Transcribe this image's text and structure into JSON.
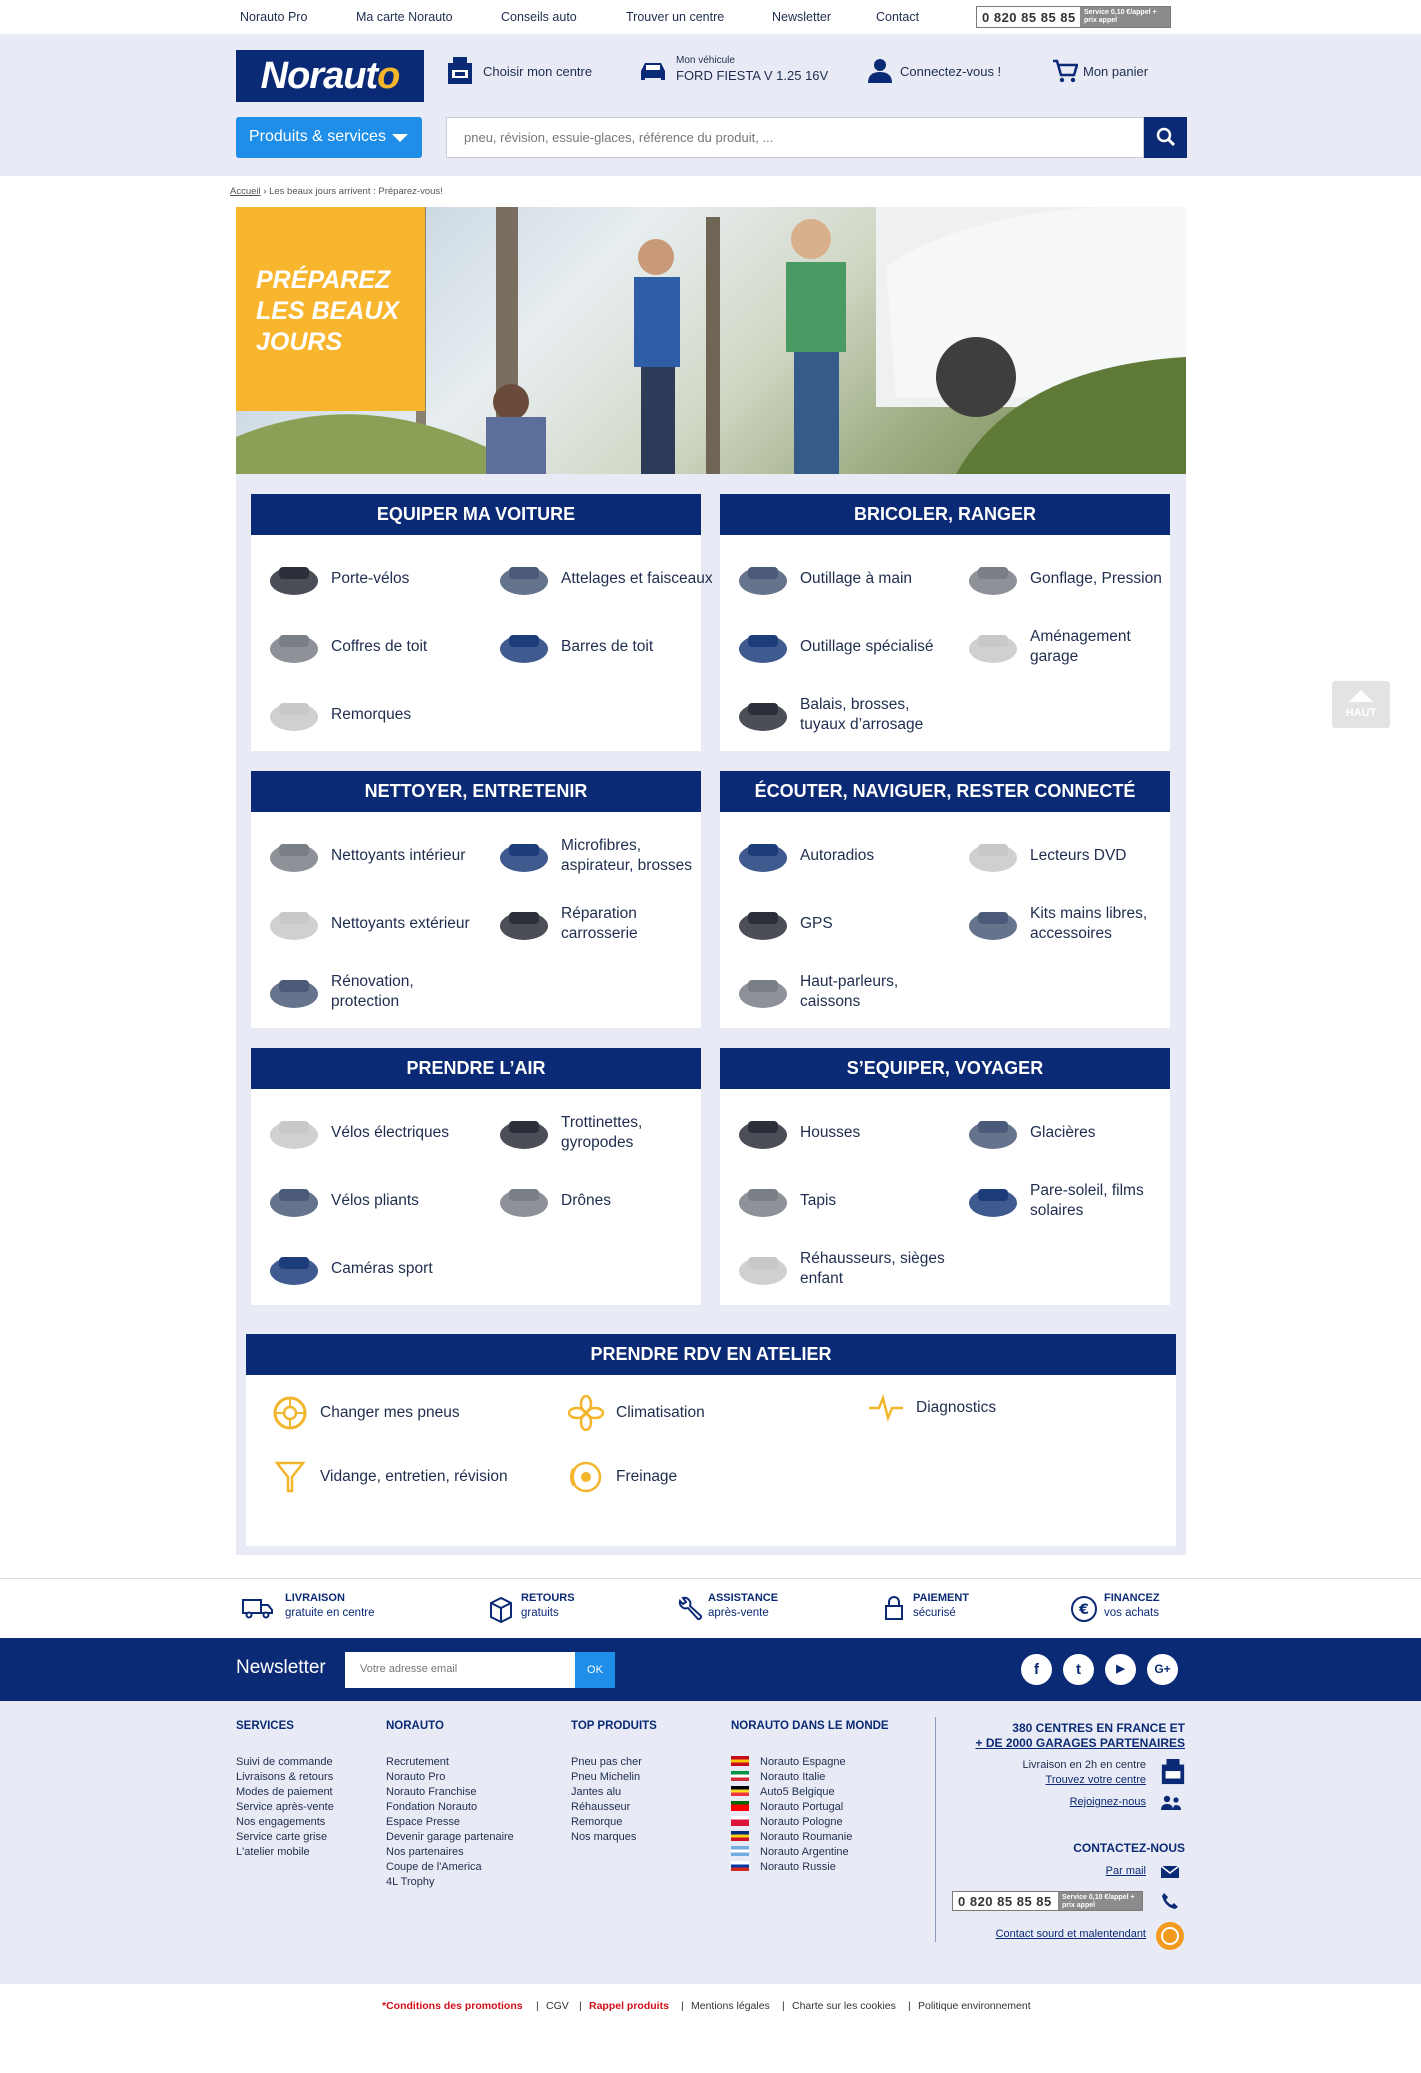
{
  "topbar": {
    "links": [
      "Norauto Pro",
      "Ma carte Norauto",
      "Conseils auto",
      "Trouver un centre",
      "Newsletter",
      "Contact"
    ],
    "phone": "0 820 85 85 85",
    "phone_tag": "Service 0,10 €/appel + prix appel"
  },
  "header": {
    "logo_text": "Norauto",
    "choose_center": "Choisir mon centre",
    "vehicle_label": "Mon véhicule",
    "vehicle_name": "FORD FIESTA V 1.25 16V",
    "login": "Connectez-vous !",
    "cart": "Mon panier",
    "products_button": "Produits & services",
    "search_placeholder": "pneu, révision, essuie-glaces, référence du produit, ..."
  },
  "breadcrumb": {
    "home": "Accueil",
    "separator": " › ",
    "current": "Les beaux jours arrivent : Préparez-vous!"
  },
  "hero": {
    "title_lines": [
      "PRÉPAREZ",
      "LES BEAUX",
      "JOURS"
    ]
  },
  "categories": [
    {
      "title": "EQUIPER MA VOITURE",
      "items": [
        {
          "label": "Porte-vélos",
          "icon": "bike-rack-icon"
        },
        {
          "label": "Attelages et faisceaux",
          "icon": "towbar-icon"
        },
        {
          "label": "Coffres de toit",
          "icon": "roof-box-icon"
        },
        {
          "label": "Barres de toit",
          "icon": "roof-bars-icon"
        },
        {
          "label": "Remorques",
          "icon": "trailer-icon"
        }
      ]
    },
    {
      "title": "BRICOLER, RANGER",
      "items": [
        {
          "label": "Outillage à main",
          "icon": "toolbox-icon"
        },
        {
          "label": "Gonflage, Pression",
          "icon": "compressor-icon"
        },
        {
          "label": "Outillage spécialisé",
          "icon": "creeper-icon"
        },
        {
          "label": "Aménagement garage",
          "icon": "tool-cabinet-icon"
        },
        {
          "label": "Balais, brosses, tuyaux d’arrosage",
          "icon": "brush-icon"
        }
      ]
    },
    {
      "title": "NETTOYER, ENTRETENIR",
      "items": [
        {
          "label": "Nettoyants intérieur",
          "icon": "spray-bottles-icon"
        },
        {
          "label": "Microfibres, aspirateur, brosses",
          "icon": "vacuum-icon"
        },
        {
          "label": "Nettoyants extérieur",
          "icon": "cleaner-bottles-icon"
        },
        {
          "label": "Réparation carrosserie",
          "icon": "repair-kit-icon"
        },
        {
          "label": "Rénovation, protection",
          "icon": "polish-icon"
        }
      ]
    },
    {
      "title": "ÉCOUTER, NAVIGUER, RESTER CONNECTÉ",
      "items": [
        {
          "label": "Autoradios",
          "icon": "car-radio-icon"
        },
        {
          "label": "Lecteurs DVD",
          "icon": "dvd-player-icon"
        },
        {
          "label": "GPS",
          "icon": "gps-icon"
        },
        {
          "label": "Kits mains libres, accessoires",
          "icon": "speakerphone-icon"
        },
        {
          "label": "Haut-parleurs, caissons",
          "icon": "speakers-icon"
        }
      ]
    },
    {
      "title": "PRENDRE L’AIR",
      "items": [
        {
          "label": "Vélos électriques",
          "icon": "e-bike-icon"
        },
        {
          "label": "Trottinettes, gyropodes",
          "icon": "scooter-icon"
        },
        {
          "label": "Vélos pliants",
          "icon": "folding-bike-icon"
        },
        {
          "label": "Drônes",
          "icon": "drone-icon"
        },
        {
          "label": "Caméras sport",
          "icon": "action-camera-icon"
        }
      ]
    },
    {
      "title": "S’EQUIPER, VOYAGER",
      "items": [
        {
          "label": "Housses",
          "icon": "seat-covers-icon"
        },
        {
          "label": "Glacières",
          "icon": "cooler-icon"
        },
        {
          "label": "Tapis",
          "icon": "car-mats-icon"
        },
        {
          "label": "Pare-soleil, films solaires",
          "icon": "sunshade-icon"
        },
        {
          "label": "Réhausseurs, sièges enfant",
          "icon": "child-seat-icon"
        }
      ]
    }
  ],
  "rdv": {
    "title": "PRENDRE RDV EN ATELIER",
    "items": [
      {
        "label": "Changer mes pneus",
        "icon": "tire-icon"
      },
      {
        "label": "Climatisation",
        "icon": "fan-icon"
      },
      {
        "label": "Diagnostics",
        "icon": "pulse-icon"
      },
      {
        "label": "Vidange, entretien, révision",
        "icon": "funnel-icon"
      },
      {
        "label": "Freinage",
        "icon": "brake-icon"
      }
    ]
  },
  "haut_button": "HAUT",
  "reassurance": [
    {
      "title": "LIVRAISON",
      "sub": "gratuite en centre",
      "icon": "truck-icon"
    },
    {
      "title": "RETOURS",
      "sub": "gratuits",
      "icon": "box-icon"
    },
    {
      "title": "ASSISTANCE",
      "sub": "après-vente",
      "icon": "wrench-icon"
    },
    {
      "title": "PAIEMENT",
      "sub": "sécurisé",
      "icon": "lock-icon"
    },
    {
      "title": "FINANCEZ",
      "sub": "vos achats",
      "icon": "euro-icon"
    }
  ],
  "newsletter": {
    "label": "Newsletter",
    "placeholder": "Votre adresse email",
    "ok": "OK",
    "social": [
      "f",
      "t",
      "▶",
      "G+"
    ]
  },
  "footer": {
    "services": {
      "title": "SERVICES",
      "links": [
        "Suivi de commande",
        "Livraisons & retours",
        "Modes de paiement",
        "Service après-vente",
        "Nos engagements",
        "Service carte grise",
        "L'atelier mobile"
      ]
    },
    "norauto": {
      "title": "NORAUTO",
      "links": [
        "Recrutement",
        "Norauto Pro",
        "Norauto Franchise",
        "Fondation Norauto",
        "Espace Presse",
        "Devenir garage partenaire",
        "Nos partenaires",
        "Coupe de l'America",
        "4L Trophy"
      ]
    },
    "top": {
      "title": "TOP PRODUITS",
      "links": [
        "Pneu pas cher",
        "Pneu Michelin",
        "Jantes alu",
        "Réhausseur",
        "Remorque",
        "Nos marques"
      ]
    },
    "world": {
      "title": "NORAUTO DANS LE MONDE",
      "links": [
        {
          "label": "Norauto Espagne",
          "colors": [
            "#c60b1e",
            "#ffc400",
            "#c60b1e"
          ]
        },
        {
          "label": "Norauto Italie",
          "colors": [
            "#009246",
            "#ffffff",
            "#ce2b37"
          ]
        },
        {
          "label": "Auto5 Belgique",
          "colors": [
            "#000000",
            "#fdda24",
            "#ef3340"
          ]
        },
        {
          "label": "Norauto Portugal",
          "colors": [
            "#006600",
            "#ff0000",
            "#ff0000"
          ]
        },
        {
          "label": "Norauto Pologne",
          "colors": [
            "#ffffff",
            "#dc143c",
            "#dc143c"
          ]
        },
        {
          "label": "Norauto Roumanie",
          "colors": [
            "#002b7f",
            "#fcd116",
            "#ce1126"
          ]
        },
        {
          "label": "Norauto Argentine",
          "colors": [
            "#74acdf",
            "#ffffff",
            "#74acdf"
          ]
        },
        {
          "label": "Norauto Russie",
          "colors": [
            "#ffffff",
            "#0039a6",
            "#d52b1e"
          ]
        }
      ]
    },
    "right": {
      "headline1": "380 CENTRES EN FRANCE ET",
      "headline2": "+ DE 2000 GARAGES PARTENAIRES",
      "delivery": "Livraison en 2h en centre",
      "find_center": "Trouvez votre centre",
      "join": "Rejoignez-nous",
      "contact_title": "CONTACTEZ-NOUS",
      "mail": "Par mail",
      "phone": "0 820 85 85 85",
      "phone_tag": "Service 0,10 €/appel + prix appel",
      "deaf": "Contact sourd et malentendant"
    }
  },
  "legal": [
    {
      "label": "*Conditions des promotions",
      "red": true
    },
    {
      "label": "CGV",
      "red": false
    },
    {
      "label": "Rappel produits",
      "red": true
    },
    {
      "label": "Mentions légales",
      "red": false
    },
    {
      "label": "Charte sur les cookies",
      "red": false
    },
    {
      "label": "Politique environnement",
      "red": false
    }
  ]
}
